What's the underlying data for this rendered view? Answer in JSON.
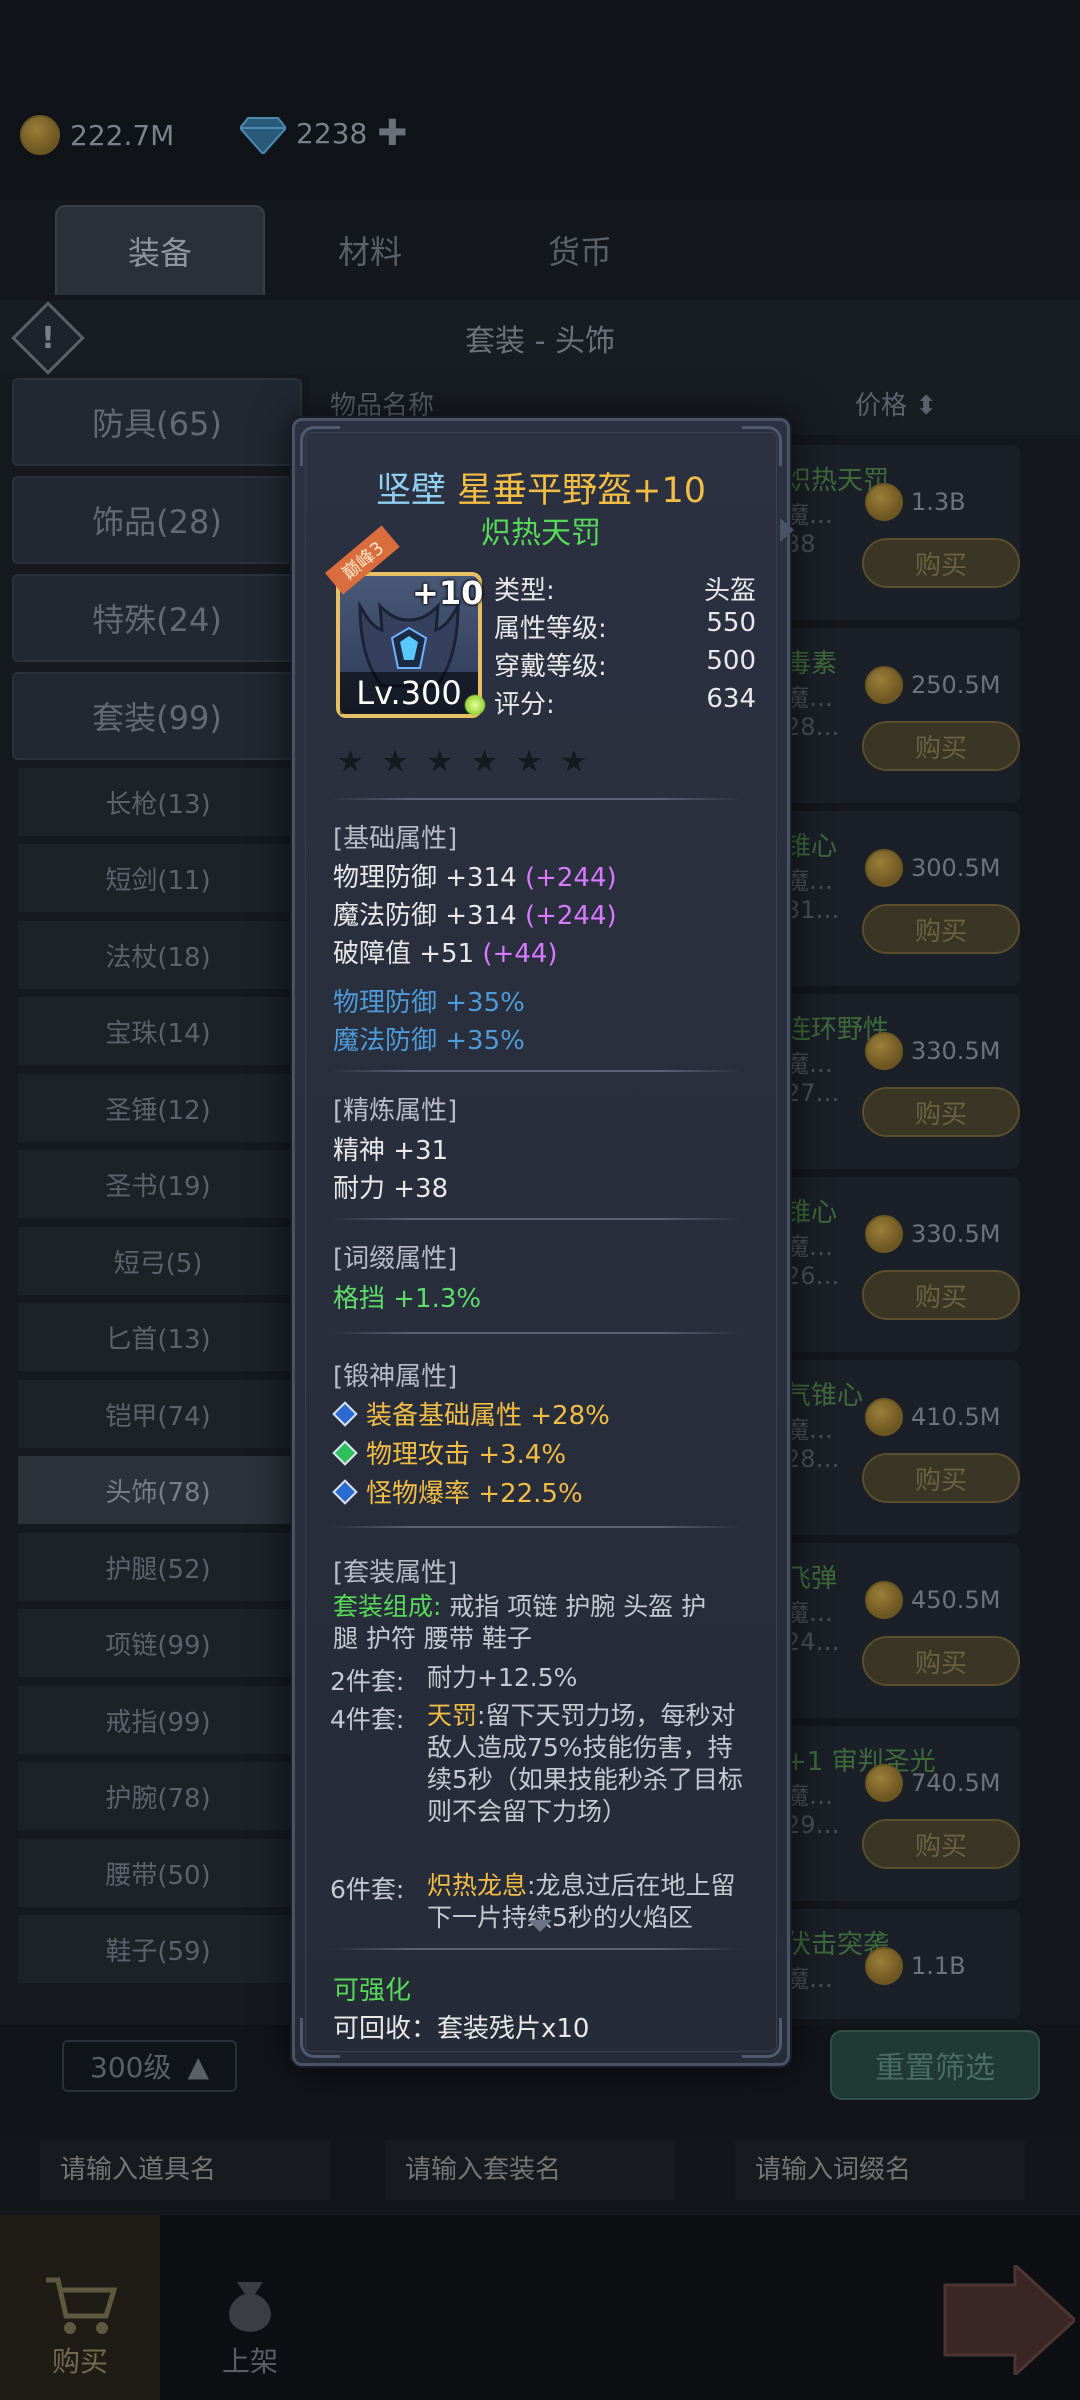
{
  "currency": {
    "gold": "222.7M",
    "gems": "2238"
  },
  "main_tabs": [
    "装备",
    "材料",
    "货币"
  ],
  "set_title": "套装 - 头饰",
  "categories": [
    "防具(65)",
    "饰品(28)",
    "特殊(24)",
    "套装(99)"
  ],
  "sub_categories": [
    "长枪(13)",
    "短剑(11)",
    "法杖(18)",
    "宝珠(14)",
    "圣锤(12)",
    "圣书(19)",
    "短弓(5)",
    "匕首(13)",
    "铠甲(74)",
    "头饰(78)",
    "护腿(52)",
    "项链(99)",
    "戒指(99)",
    "护腕(78)",
    "腰带(50)",
    "鞋子(59)"
  ],
  "list_header": {
    "name": "物品名称",
    "price": "价格"
  },
  "rows": [
    {
      "name": "炽热天罚",
      "sub": "魔…",
      "sub2": "38",
      "price": "1.3B",
      "buy": "购买"
    },
    {
      "name": "毒素",
      "sub": "魔…",
      "sub2": "28…",
      "price": "250.5M",
      "buy": "购买"
    },
    {
      "name": "锥心",
      "sub": "魔…",
      "sub2": "31…",
      "price": "300.5M",
      "buy": "购买"
    },
    {
      "name": "连环野性",
      "sub": "魔…",
      "sub2": "27…",
      "price": "330.5M",
      "buy": "购买"
    },
    {
      "name": "锥心",
      "sub": "魔…",
      "sub2": "26…",
      "price": "330.5M",
      "buy": "购买"
    },
    {
      "name": "气锥心",
      "sub": "魔…",
      "sub2": "28…",
      "price": "410.5M",
      "buy": "购买"
    },
    {
      "name": "飞弹",
      "sub": "魔…",
      "sub2": "24…",
      "price": "450.5M",
      "buy": "购买"
    },
    {
      "name": "+1 审判圣光",
      "sub": "魔…",
      "sub2": "29…",
      "price": "740.5M",
      "buy": "购买"
    },
    {
      "name": "伏击突袭",
      "sub": "魔…",
      "sub2": "",
      "price": "1.1B",
      "buy": ""
    }
  ],
  "filter": {
    "level": "300级",
    "reset": "重置筛选",
    "search_item_placeholder": "请输入道具名",
    "search_set_placeholder": "请输入套装名",
    "search_affix_placeholder": "请输入词缀名"
  },
  "bottom_nav": {
    "buy": "购买",
    "list": "上架"
  },
  "tooltip": {
    "prefix": "坚壁",
    "name": "星垂平野盔+10",
    "set_name": "炽热天罚",
    "ribbon": "巅峰3",
    "plus": "+10",
    "level": "Lv.300",
    "stats": [
      {
        "label": "类型:",
        "value": "头盔"
      },
      {
        "label": "属性等级:",
        "value": "550"
      },
      {
        "label": "穿戴等级:",
        "value": "500"
      },
      {
        "label": "评分:",
        "value": "634"
      }
    ],
    "base_title": "[基础属性]",
    "base_attrs": [
      {
        "text": "物理防御 +314 ",
        "bonus": "(+244)"
      },
      {
        "text": "魔法防御 +314 ",
        "bonus": "(+244)"
      },
      {
        "text": "破障值 +51 ",
        "bonus": "(+44)"
      }
    ],
    "pct_attrs": [
      "物理防御 +35%",
      "魔法防御 +35%"
    ],
    "refine_title": "[精炼属性]",
    "refine_attrs": [
      "精神 +31",
      "耐力 +38"
    ],
    "affix_title": "[词缀属性]",
    "affix_attrs": [
      "格挡 +1.3%"
    ],
    "forge_title": "[锻神属性]",
    "forge_attrs": [
      "装备基础属性 +28%",
      "物理攻击 +3.4%",
      "怪物爆率 +22.5%"
    ],
    "set_title": "[套装属性]",
    "set_composition_label": "套装组成:",
    "set_composition_line1": " 戒指 项链 护腕 头盔 护",
    "set_composition_line2": "腿 护符 腰带 鞋子",
    "set2_tag": "2件套:",
    "set2_desc": "耐力+12.5%",
    "set4_tag": "4件套:",
    "set4_key": "天罚",
    "set4_desc": ":留下天罚力场，每秒对敌人造成75%技能伤害，持续5秒（如果技能秒杀了目标则不会留下力场）",
    "set6_tag": "6件套:",
    "set6_key": "炽热龙息",
    "set6_desc": ":龙息过后在地上留下一片持续5秒的火焰区",
    "can_enhance": "可强化",
    "recyclable": "可回收：套装残片x10"
  }
}
